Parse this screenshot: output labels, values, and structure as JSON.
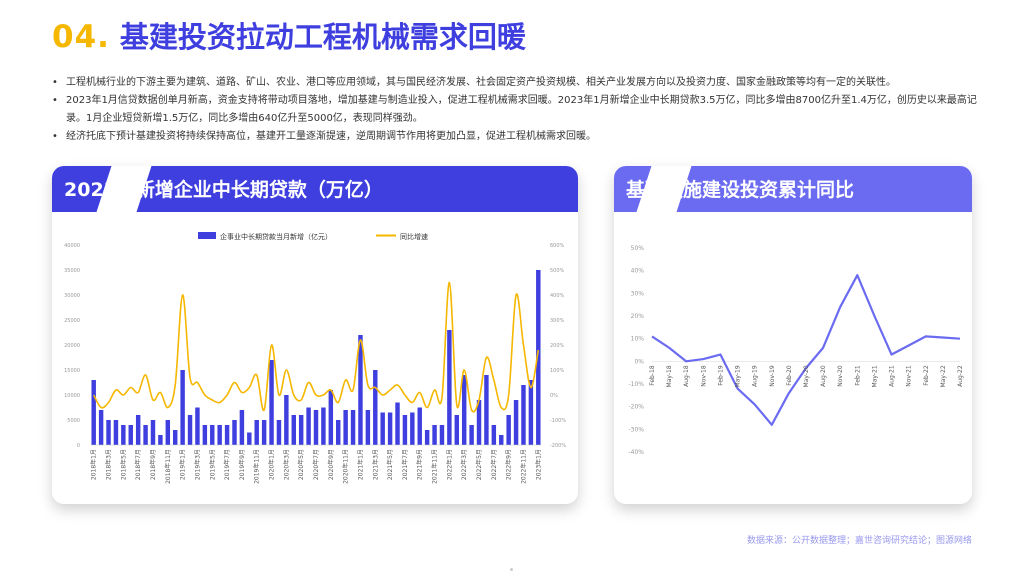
{
  "header": {
    "number": "04.",
    "title": "基建投资拉动工程机械需求回暖"
  },
  "bullets": [
    "工程机械行业的下游主要为建筑、道路、矿山、农业、港口等应用领域，其与国民经济发展、社会固定资产投资规模、相关产业发展方向以及投资力度、国家金融政策等均有一定的关联性。",
    "2023年1月信贷数据创单月新高，资金支持将带动项目落地，增加基建与制造业投入，促进工程机械需求回暖。2023年1月新增企业中长期贷款3.5万亿，同比多增由8700亿升至1.4万亿，创历史以来最高记录。1月企业短贷新增1.5万亿，同比多增由640亿升至5000亿，表现同样强劲。",
    "经济托底下预计基建投资将持续保持高位，基建开工量逐渐提速，逆周期调节作用将更加凸显，促进工程机械需求回暖。"
  ],
  "left_card": {
    "title": "2023年新增企业中长期贷款（万亿）"
  },
  "right_card": {
    "title": "基础设施建设投资累计同比"
  },
  "source": "数据来源：公开数据整理；嘉世咨询研究结论；图源网络",
  "colors": {
    "blue": "#3f3fe0",
    "yellow": "#f5b700",
    "line": "#6b6bf2"
  },
  "chart_data": [
    {
      "type": "bar",
      "title": "",
      "legend": [
        "企事业中长期贷款当月新增（亿元）",
        "同比增速"
      ],
      "legend_position": "top",
      "xlabel": "",
      "ylabel": "",
      "ylim": [
        0,
        40000
      ],
      "y2lim": [
        -200,
        600
      ],
      "yticks": [
        "0",
        "5000",
        "10000",
        "15000",
        "20000",
        "25000",
        "30000",
        "35000",
        "40000"
      ],
      "y2ticks": [
        "-200%",
        "-100%",
        "0%",
        "100%",
        "200%",
        "300%",
        "400%",
        "500%",
        "600%"
      ],
      "x": [
        "2018年1月",
        "2018年2月",
        "2018年3月",
        "2018年4月",
        "2018年5月",
        "2018年6月",
        "2018年7月",
        "2018年8月",
        "2018年9月",
        "2018年10月",
        "2018年11月",
        "2018年12月",
        "2019年1月",
        "2019年2月",
        "2019年3月",
        "2019年4月",
        "2019年5月",
        "2019年6月",
        "2019年7月",
        "2019年8月",
        "2019年9月",
        "2019年10月",
        "2019年11月",
        "2019年12月",
        "2020年1月",
        "2020年2月",
        "2020年3月",
        "2020年4月",
        "2020年5月",
        "2020年6月",
        "2020年7月",
        "2020年8月",
        "2020年9月",
        "2020年10月",
        "2020年11月",
        "2020年12月",
        "2021年1月",
        "2021年2月",
        "2021年3月",
        "2021年4月",
        "2021年5月",
        "2021年6月",
        "2021年7月",
        "2021年8月",
        "2021年9月",
        "2021年10月",
        "2021年11月",
        "2021年12月",
        "2022年1月",
        "2022年2月",
        "2022年3月",
        "2022年4月",
        "2022年5月",
        "2022年6月",
        "2022年7月",
        "2022年8月",
        "2022年9月",
        "2022年10月",
        "2022年11月",
        "2022年12月",
        "2023年1月"
      ],
      "x_tick_labels": [
        "2018年1月",
        "2018年3月",
        "2018年5月",
        "2018年7月",
        "2018年9月",
        "2018年11月",
        "2019年1月",
        "2019年3月",
        "2019年5月",
        "2019年7月",
        "2019年9月",
        "2019年11月",
        "2020年1月",
        "2020年3月",
        "2020年5月",
        "2020年7月",
        "2020年9月",
        "2020年11月",
        "2021年1月",
        "2021年3月",
        "2021年5月",
        "2021年7月",
        "2021年9月",
        "2021年11月",
        "2022年1月",
        "2022年3月",
        "2022年5月",
        "2022年7月",
        "2022年9月",
        "2022年11月",
        "2023年1月"
      ],
      "series": [
        {
          "name": "企事业中长期贷款当月新增（亿元）",
          "type": "bar",
          "values": [
            13000,
            7000,
            5000,
            5000,
            4000,
            4000,
            6000,
            4000,
            5000,
            2000,
            5000,
            3000,
            15000,
            6000,
            7500,
            4000,
            4000,
            4000,
            4000,
            5000,
            7000,
            2500,
            5000,
            5000,
            17000,
            5000,
            10000,
            6000,
            6000,
            7500,
            7000,
            7500,
            11000,
            5000,
            7000,
            7000,
            22000,
            7000,
            15000,
            6500,
            6500,
            8500,
            6000,
            6500,
            7500,
            3000,
            4000,
            4000,
            23000,
            6000,
            14000,
            4000,
            9000,
            14000,
            4000,
            2000,
            6000,
            9000,
            12000,
            13000,
            35000
          ]
        },
        {
          "name": "同比增速",
          "type": "line",
          "axis": "right",
          "values": [
            0,
            -50,
            -30,
            20,
            0,
            30,
            10,
            80,
            -20,
            10,
            -50,
            40,
            400,
            70,
            50,
            0,
            -20,
            -30,
            0,
            50,
            10,
            30,
            80,
            -60,
            200,
            0,
            100,
            0,
            -20,
            50,
            0,
            0,
            20,
            -30,
            60,
            20,
            220,
            40,
            30,
            0,
            20,
            40,
            0,
            -30,
            10,
            -50,
            20,
            -10,
            450,
            -40,
            100,
            -60,
            -20,
            150,
            60,
            -50,
            0,
            400,
            200,
            30,
            180
          ]
        }
      ]
    },
    {
      "type": "line",
      "title": "",
      "xlabel": "",
      "ylabel": "",
      "ylim": [
        -40,
        50
      ],
      "yticks": [
        "-40%",
        "-30%",
        "-20%",
        "-10%",
        "0%",
        "10%",
        "20%",
        "30%",
        "40%",
        "50%"
      ],
      "x": [
        "Feb-18",
        "May-18",
        "Aug-18",
        "Nov-18",
        "Feb-19",
        "May-19",
        "Aug-19",
        "Nov-19",
        "Feb-20",
        "May-20",
        "Aug-20",
        "Nov-20",
        "Feb-21",
        "May-21",
        "Aug-21",
        "Nov-21",
        "Feb-22",
        "May-22",
        "Aug-22"
      ],
      "series": [
        {
          "name": "",
          "values": [
            11,
            6,
            0,
            1,
            3,
            -12,
            -19,
            -28,
            -14,
            -3,
            6,
            24,
            38,
            20,
            3,
            7,
            11,
            10.5,
            10
          ]
        }
      ]
    }
  ]
}
